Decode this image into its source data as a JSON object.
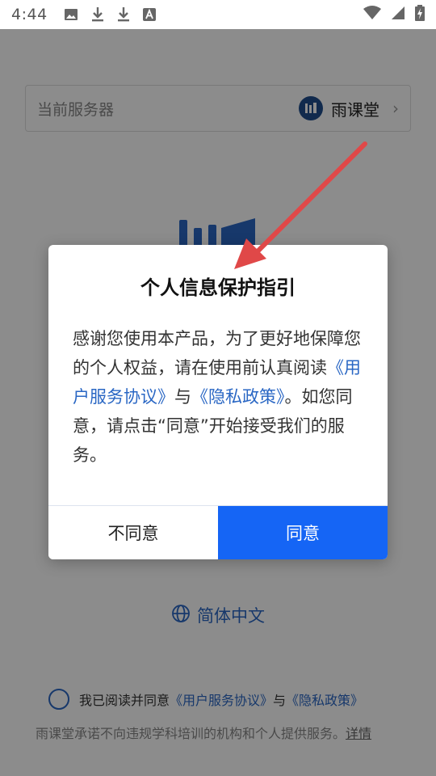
{
  "status_bar": {
    "time": "4:44",
    "icons": [
      "image-icon",
      "download-icon",
      "download-icon",
      "font-icon"
    ],
    "right_icons": [
      "wifi-icon",
      "signal-icon",
      "battery-charging-icon"
    ]
  },
  "login": {
    "server_label": "当前服务器",
    "server_name": "雨课堂",
    "language": "简体中文",
    "agree_prefix": "我已阅读并同意",
    "agree_link_terms": "《用户服务协议》",
    "agree_and": "与",
    "agree_link_privacy": "《隐私政策》",
    "footnote": "雨课堂承诺不向违规学科培训的机构和个人提供服务。",
    "footnote_detail": "详情"
  },
  "dialog": {
    "title": "个人信息保护指引",
    "body_part1": "感谢您使用本产品，为了更好地保障您的个人权益，请在使用前认真阅读",
    "link_terms": "《用户服务协议》",
    "body_and": "与",
    "link_privacy": "《隐私政策》",
    "body_part2": "。如您同意，请点击“同意”开始接受我们的服务。",
    "disagree_label": "不同意",
    "agree_label": "同意"
  },
  "colors": {
    "accent": "#1565f5",
    "link": "#2a67c4",
    "annotation_arrow": "#e04848"
  }
}
